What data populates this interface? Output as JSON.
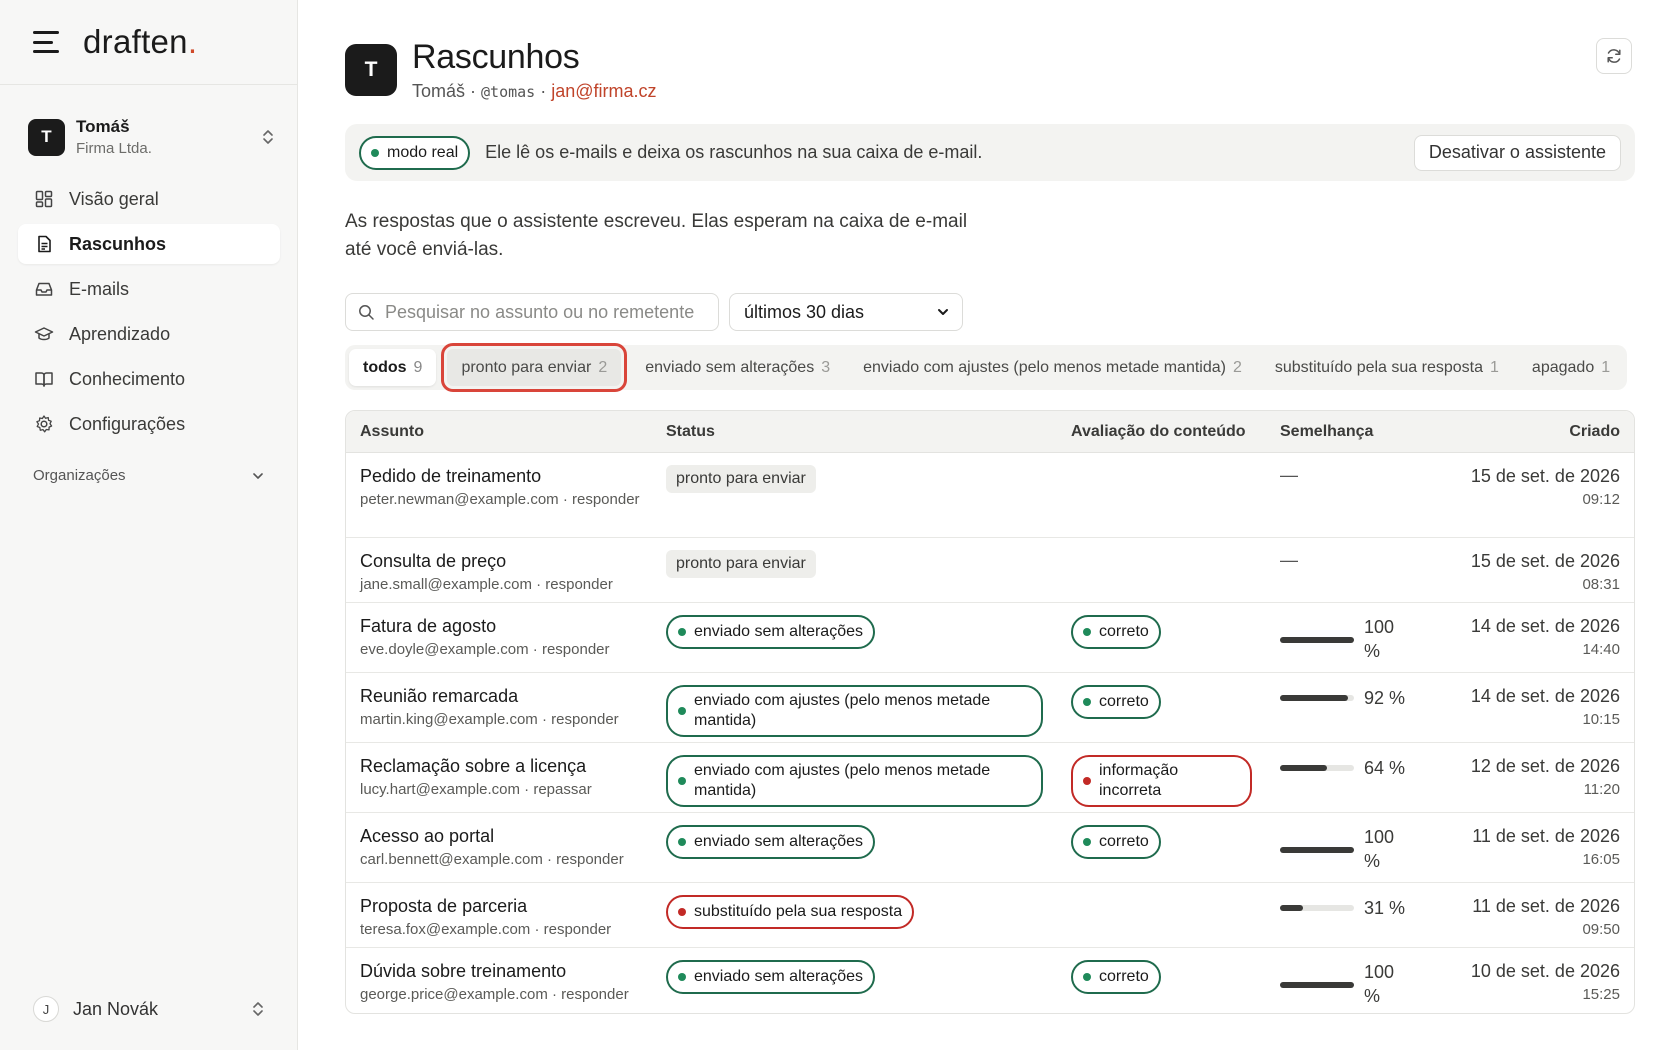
{
  "brand": {
    "name": "draften",
    "dot": "."
  },
  "workspace": {
    "initial": "T",
    "name": "Tomáš",
    "org": "Firma Ltda."
  },
  "nav": [
    {
      "label": "Visão geral",
      "icon": "dashboard-icon",
      "active": false
    },
    {
      "label": "Rascunhos",
      "icon": "document-icon",
      "active": true
    },
    {
      "label": "E-mails",
      "icon": "inbox-icon",
      "active": false
    },
    {
      "label": "Aprendizado",
      "icon": "graduation-cap-icon",
      "active": false
    },
    {
      "label": "Conhecimento",
      "icon": "book-icon",
      "active": false
    },
    {
      "label": "Configurações",
      "icon": "gear-icon",
      "active": false
    }
  ],
  "orgs_label": "Organizações",
  "user": {
    "initial": "J",
    "name": "Jan Novák"
  },
  "header": {
    "initial": "T",
    "title": "Rascunhos",
    "name": "Tomáš",
    "sep1": " · ",
    "handle": "@tomas",
    "sep2": " · ",
    "email": "jan@firma.cz"
  },
  "banner": {
    "mode": "modo real",
    "text": "Ele lê os e-mails e deixa os rascunhos na sua caixa de e-mail.",
    "deactivate": "Desativar o assistente"
  },
  "intro": "As respostas que o assistente escreveu. Elas esperam na caixa de e-mail até você enviá-las.",
  "search": {
    "placeholder": "Pesquisar no assunto ou no remetente"
  },
  "period": {
    "selected": "últimos 30 dias"
  },
  "tabs": [
    {
      "label": "todos",
      "count": "9"
    },
    {
      "label": "pronto para enviar",
      "count": "2"
    },
    {
      "label": "enviado sem alterações",
      "count": "3"
    },
    {
      "label": "enviado com ajustes (pelo menos metade mantida)",
      "count": "2"
    },
    {
      "label": "substituído pela sua resposta",
      "count": "1"
    },
    {
      "label": "apagado",
      "count": "1"
    }
  ],
  "table": {
    "headers": {
      "subject": "Assunto",
      "status": "Status",
      "eval": "Avaliação do conteúdo",
      "similarity": "Semelhança",
      "created": "Criado"
    },
    "rows": [
      {
        "subject": "Pedido de treinamento",
        "from": "peter.newman@example.com · responder",
        "status": "pronto para enviar",
        "status_kind": "gray",
        "eval": "",
        "eval_kind": "",
        "sim_text": "—",
        "sim_value": null,
        "date": "15 de set. de 2026",
        "time": "09:12"
      },
      {
        "subject": "Consulta de preço",
        "from": "jane.small@example.com · responder",
        "status": "pronto para enviar",
        "status_kind": "gray",
        "eval": "",
        "eval_kind": "",
        "sim_text": "—",
        "sim_value": null,
        "date": "15 de set. de 2026",
        "time": "08:31"
      },
      {
        "subject": "Fatura de agosto",
        "from": "eve.doyle@example.com · responder",
        "status": "enviado sem alterações",
        "status_kind": "green",
        "eval": "correto",
        "eval_kind": "green",
        "sim_text": "100 %",
        "sim_value": 100,
        "date": "14 de set. de 2026",
        "time": "14:40"
      },
      {
        "subject": "Reunião remarcada",
        "from": "martin.king@example.com · responder",
        "status": "enviado com ajustes (pelo menos metade mantida)",
        "status_kind": "green-wide",
        "eval": "correto",
        "eval_kind": "green",
        "sim_text": "92 %",
        "sim_value": 92,
        "date": "14 de set. de 2026",
        "time": "10:15"
      },
      {
        "subject": "Reclamação sobre a licença",
        "from": "lucy.hart@example.com · repassar",
        "status": "enviado com ajustes (pelo menos metade mantida)",
        "status_kind": "green-wide",
        "eval": "informação incorreta",
        "eval_kind": "red-wide",
        "sim_text": "64 %",
        "sim_value": 64,
        "date": "12 de set. de 2026",
        "time": "11:20"
      },
      {
        "subject": "Acesso ao portal",
        "from": "carl.bennett@example.com · responder",
        "status": "enviado sem alterações",
        "status_kind": "green",
        "eval": "correto",
        "eval_kind": "green",
        "sim_text": "100 %",
        "sim_value": 100,
        "date": "11 de set. de 2026",
        "time": "16:05"
      },
      {
        "subject": "Proposta de parceria",
        "from": "teresa.fox@example.com · responder",
        "status": "substituído pela sua resposta",
        "status_kind": "red",
        "eval": "",
        "eval_kind": "",
        "sim_text": "31 %",
        "sim_value": 31,
        "date": "11 de set. de 2026",
        "time": "09:50"
      },
      {
        "subject": "Dúvida sobre treinamento",
        "from": "george.price@example.com · responder",
        "status": "enviado sem alterações",
        "status_kind": "green",
        "eval": "correto",
        "eval_kind": "green",
        "sim_text": "100 %",
        "sim_value": 100,
        "date": "10 de set. de 2026",
        "time": "15:25"
      }
    ]
  },
  "colors": {
    "accent": "#c0442a",
    "green": "#1f6b4d",
    "red": "#c22a26",
    "highlight": "#d9453a"
  }
}
